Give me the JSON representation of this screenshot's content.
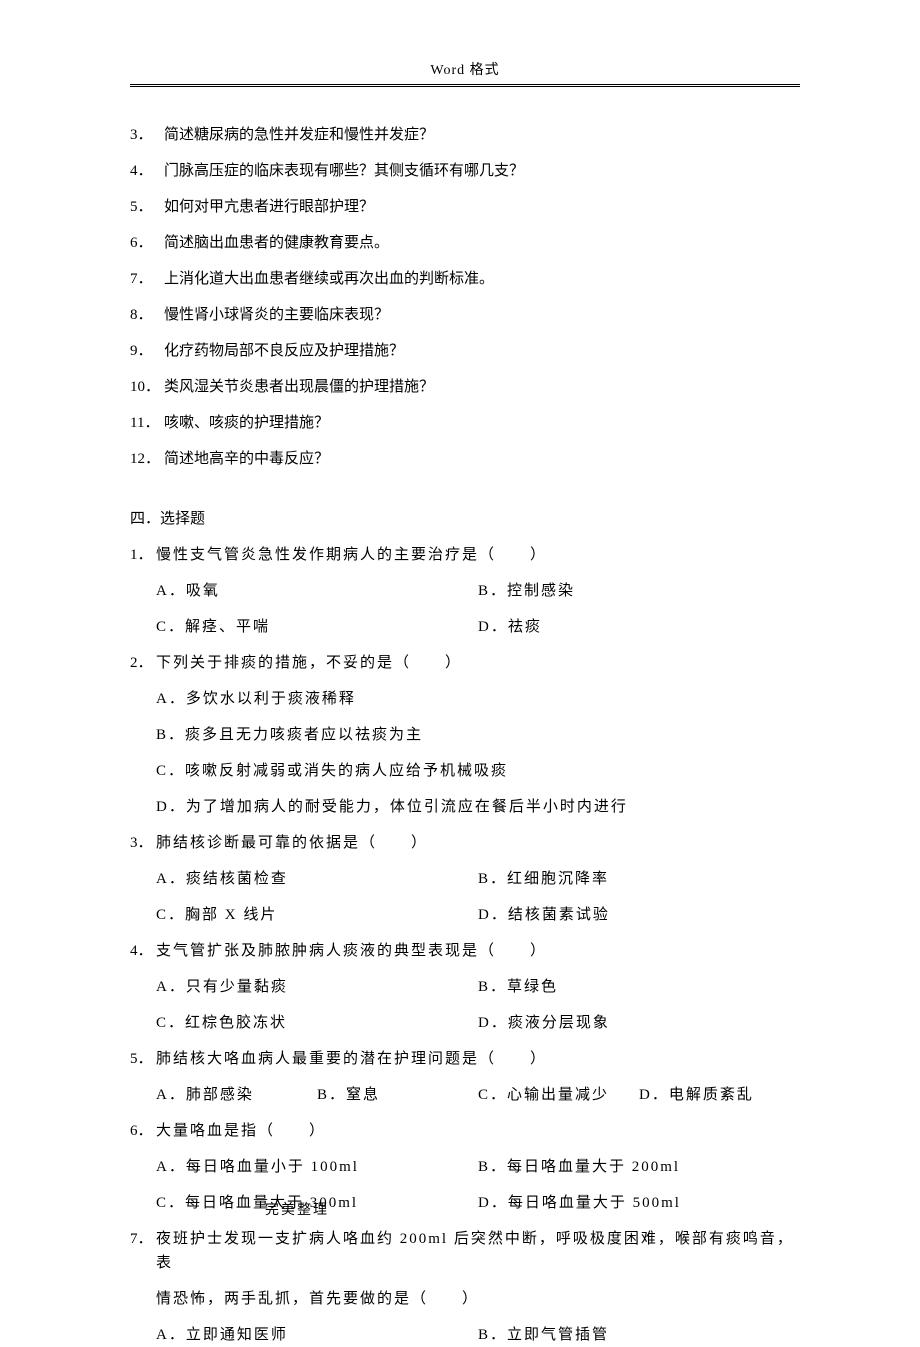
{
  "header": "Word 格式",
  "footer": "完美整理",
  "essay": [
    {
      "num": "3．",
      "text": "简述糖尿病的急性并发症和慢性并发症？"
    },
    {
      "num": "4．",
      "text": "门脉高压症的临床表现有哪些？其侧支循环有哪几支？"
    },
    {
      "num": "5．",
      "text": "如何对甲亢患者进行眼部护理？"
    },
    {
      "num": "6．",
      "text": "简述脑出血患者的健康教育要点。"
    },
    {
      "num": "7．",
      "text": "上消化道大出血患者继续或再次出血的判断标准。"
    },
    {
      "num": "8．",
      "text": "慢性肾小球肾炎的主要临床表现？"
    },
    {
      "num": "9．",
      "text": "化疗药物局部不良反应及护理措施？"
    },
    {
      "num": "10．",
      "text": "类风湿关节炎患者出现晨僵的护理措施？"
    },
    {
      "num": "11．",
      "text": "咳嗽、咳痰的护理措施？"
    },
    {
      "num": "12．",
      "text": "简述地高辛的中毒反应？"
    }
  ],
  "section4_title": "四．选择题",
  "questions": [
    {
      "num": "1．",
      "stem": "慢性支气管炎急性发作期病人的主要治疗是（　　）",
      "layout": "2x2",
      "opts": [
        "A．吸氧",
        "B．控制感染",
        "C．解痉、平喘",
        "D．祛痰"
      ]
    },
    {
      "num": "2．",
      "stem": "下列关于排痰的措施，不妥的是（　　）",
      "layout": "1x4",
      "opts": [
        "A．多饮水以利于痰液稀释",
        "B．痰多且无力咳痰者应以祛痰为主",
        "C．咳嗽反射减弱或消失的病人应给予机械吸痰",
        "D．为了增加病人的耐受能力，体位引流应在餐后半小时内进行"
      ]
    },
    {
      "num": "3．",
      "stem": "肺结核诊断最可靠的依据是（　　）",
      "layout": "2x2",
      "opts": [
        "A．痰结核菌检查",
        "B．红细胞沉降率",
        "C．胸部 X 线片",
        "D．结核菌素试验"
      ]
    },
    {
      "num": "4．",
      "stem": "支气管扩张及肺脓肿病人痰液的典型表现是（　　）",
      "layout": "2x2",
      "opts": [
        "A．只有少量黏痰",
        "B．草绿色",
        "C．红棕色胶冻状",
        "D．痰液分层现象"
      ]
    },
    {
      "num": "5．",
      "stem": "肺结核大咯血病人最重要的潜在护理问题是（　　）",
      "layout": "4x1",
      "opts": [
        "A．肺部感染",
        "B．窒息",
        "C．心输出量减少",
        "D．电解质紊乱"
      ]
    },
    {
      "num": "6．",
      "stem": "大量咯血是指（　　）",
      "layout": "2x2",
      "opts": [
        "A．每日咯血量小于 100ml",
        "B．每日咯血量大于 200ml",
        "C．每日咯血量大于 300ml",
        "D．每日咯血量大于 500ml"
      ]
    },
    {
      "num": "7．",
      "stem": "夜班护士发现一支扩病人咯血约 200ml 后突然中断，呼吸极度困难，喉部有痰鸣音，表",
      "stem2": "情恐怖，两手乱抓，首先要做的是（　　）",
      "layout": "2x1",
      "opts": [
        "A．立即通知医师",
        "B．立即气管插管"
      ]
    }
  ]
}
